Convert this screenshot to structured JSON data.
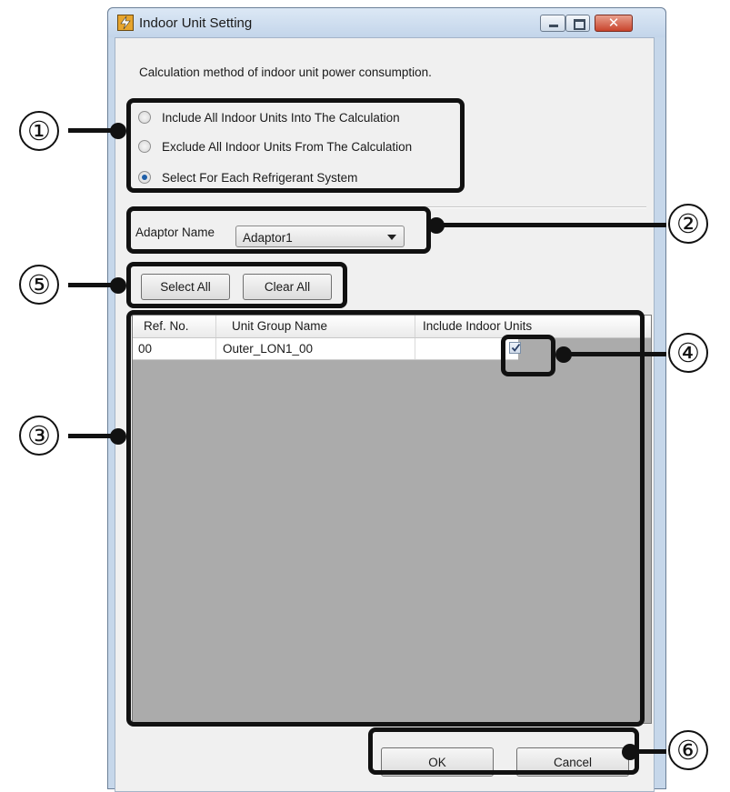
{
  "window": {
    "title": "Indoor Unit Setting",
    "controls": {
      "minimize": "minimize",
      "maximize": "maximize",
      "close": "✕"
    }
  },
  "description": "Calculation method of indoor unit power consumption.",
  "radio_options": [
    {
      "label": "Include All Indoor Units Into The Calculation",
      "selected": false
    },
    {
      "label": "Exclude All Indoor Units From The Calculation",
      "selected": false
    },
    {
      "label": "Select For Each Refrigerant System",
      "selected": true
    }
  ],
  "adaptor": {
    "label": "Adaptor Name",
    "selected": "Adaptor1"
  },
  "buttons": {
    "select_all": "Select All",
    "clear_all": "Clear All",
    "ok": "OK",
    "cancel": "Cancel"
  },
  "grid": {
    "columns": [
      "Ref. No.",
      "Unit Group Name",
      "Include Indoor Units"
    ],
    "rows": [
      {
        "ref_no": "00",
        "unit_group": "Outer_LON1_00",
        "include": true
      }
    ]
  },
  "callouts": [
    "①",
    "②",
    "③",
    "④",
    "⑤",
    "⑥"
  ],
  "colors": {
    "accent": "#1f5fa8",
    "grid_background": "#ababab",
    "annotation": "#111111"
  }
}
